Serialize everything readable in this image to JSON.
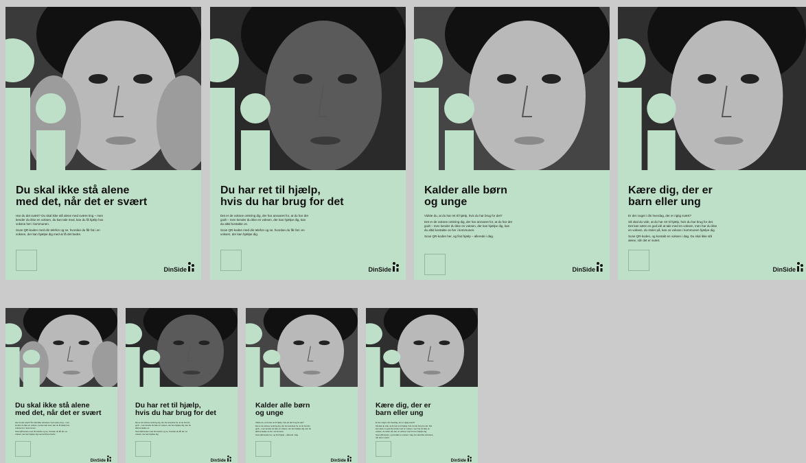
{
  "posters": [
    {
      "title": "Du skal ikke stå alene\nmed det, når det er svært",
      "body": [
        "Har du det svært? Du skal ikke stå alene med svære ting – men kender du ikke en voksen, du kan tale med, kan du få hjælp hos voksne her i kommunen.",
        "Scan QR-koden med din telefon og se, hvordan du får fat i en voksen, der kan hjælpe dig med at få det bedre."
      ],
      "logo": "DinSide",
      "bg": "#3a3a3a"
    },
    {
      "title": "Du har ret til hjælp,\nhvis du har brug for det",
      "body": [
        "Det er de voksne omkring dig, der har ansvaret for, at du har det godt – men kender du ikke en voksen, der kan hjælpe dig, kan du altid kontakte os.",
        "Scan QR-koden med din telefon og se, hvordan du får fat i en voksen, der kan hjælpe dig."
      ],
      "logo": "DinSide",
      "bg": "#2a2a2a"
    },
    {
      "title": "Kalder alle børn\nog unge",
      "body": [
        "Vidste du, at du har ret til hjælp, hvis du har brug for det?",
        "Det er de voksne omkring dig, der har ansvaret for, at du har det godt – men kender du ikke en voksen, der kan hjælpe dig, kan du altid kontakte os her i kommunen.",
        "Scan QR-koden her, og find hjælp – allerede i dag."
      ],
      "logo": "DinSide",
      "bg": "#454545"
    },
    {
      "title": "Kære dig, der er\nbarn eller ung",
      "body": [
        "Er der noget i din hverdag, der er rigtig svært?",
        "Så skal du vide, at du har ret til hjælp, hvis du har brug for det. Det kan være en god idé at tale med en voksen, men har du ikke en voksen, du stoler på, kan os voksne i kommunen hjælpe dig.",
        "Scan QR-koden, og kontakt en voksen i dag. Du skal ikke stå alene, når det er svært."
      ],
      "logo": "DinSide",
      "bg": "#2f2f2f"
    }
  ],
  "colors": {
    "mint": "#bfe0c8",
    "page": "#cbcbcb"
  }
}
